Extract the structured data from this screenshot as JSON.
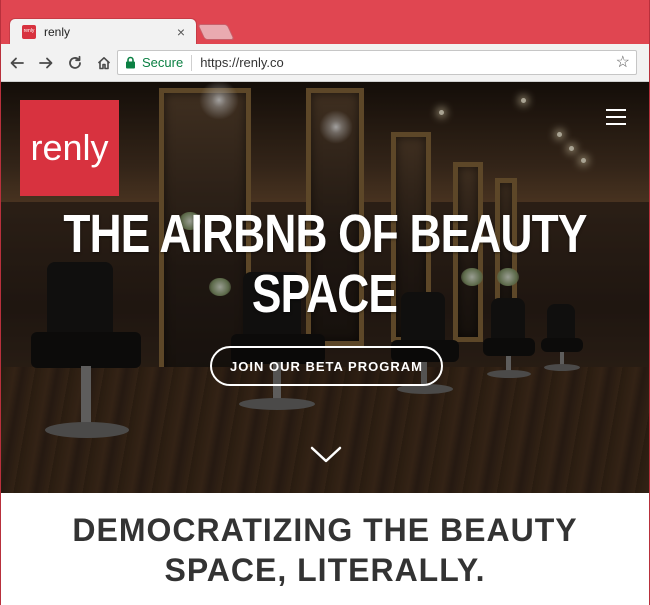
{
  "browser": {
    "tab": {
      "favicon_text": "renly",
      "title": "renly",
      "close_label": "×"
    },
    "toolbar": {
      "secure_label": "Secure",
      "url": "https://renly.co",
      "star_label": "☆"
    }
  },
  "hero": {
    "logo_text": "renly",
    "headline_line1": "THE AIRBNB OF BEAUTY",
    "headline_line2": "SPACE",
    "cta_label": "JOIN OUR BETA PROGRAM"
  },
  "section": {
    "tagline_line1": "DEMOCRATIZING THE BEAUTY",
    "tagline_line2": "SPACE, LITERALLY."
  },
  "colors": {
    "chrome_accent": "#e04651",
    "brand_red": "#d8323f",
    "secure_green": "#0b8043",
    "tagline_text": "#333333"
  },
  "icons": {
    "back": "back-arrow-icon",
    "forward": "forward-arrow-icon",
    "reload": "reload-icon",
    "home": "home-icon",
    "lock": "lock-icon",
    "star": "star-icon",
    "menu": "hamburger-menu-icon",
    "scroll": "chevron-down-icon"
  }
}
